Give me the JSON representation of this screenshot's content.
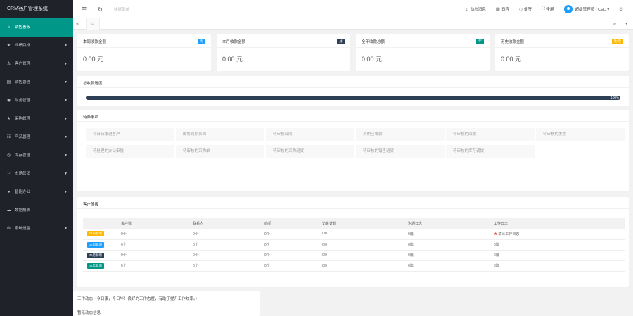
{
  "app_title": "CRM客户管理系统",
  "sidebar": {
    "items": [
      {
        "label": "销售看板",
        "icon": "home-icon",
        "glyph": "⌂",
        "active": true,
        "has_caret": false
      },
      {
        "label": "业绩目标",
        "icon": "star-icon",
        "glyph": "★",
        "active": false,
        "has_caret": true
      },
      {
        "label": "客户管理",
        "icon": "user-icon",
        "glyph": "♙",
        "active": false,
        "has_caret": true
      },
      {
        "label": "销售管理",
        "icon": "chart-icon",
        "glyph": "▤",
        "active": false,
        "has_caret": true
      },
      {
        "label": "财务管理",
        "icon": "money-icon",
        "glyph": "◉",
        "active": false,
        "has_caret": true
      },
      {
        "label": "采购管理",
        "icon": "star-icon",
        "glyph": "★",
        "active": false,
        "has_caret": true
      },
      {
        "label": "产品管理",
        "icon": "product-icon",
        "glyph": "☷",
        "active": false,
        "has_caret": true
      },
      {
        "label": "库存管理",
        "icon": "stock-icon",
        "glyph": "◎",
        "active": false,
        "has_caret": true
      },
      {
        "label": "市场营销",
        "icon": "flag-icon",
        "glyph": "⚐",
        "active": false,
        "has_caret": true
      },
      {
        "label": "智能办公",
        "icon": "office-icon",
        "glyph": "●",
        "active": false,
        "has_caret": true
      },
      {
        "label": "数据报表",
        "icon": "report-icon",
        "glyph": "☁",
        "active": false,
        "has_caret": false
      },
      {
        "label": "系统设置",
        "icon": "gear-icon",
        "glyph": "⚙",
        "active": false,
        "has_caret": true
      }
    ]
  },
  "header": {
    "menu_glyph": "☰",
    "refresh_glyph": "↻",
    "quick_menu": "快捷菜单",
    "right": [
      {
        "label": "动态消息",
        "icon": "bell-icon",
        "glyph": "♫"
      },
      {
        "label": "日程",
        "icon": "calendar-icon",
        "glyph": "▦"
      },
      {
        "label": "便签",
        "icon": "tag-icon",
        "glyph": "◇"
      },
      {
        "label": "全屏",
        "icon": "fullscreen-icon",
        "glyph": "⛶"
      }
    ],
    "user": "超级管理员 - CEO ▾",
    "settings_glyph": "⚙"
  },
  "tabs": {
    "prev": "«",
    "home": "⌂",
    "next": "»",
    "menu": "▾"
  },
  "stats": [
    {
      "title": "本周收款金额",
      "badge": "周",
      "badge_color": "#1e9fff",
      "value": "0.00 元"
    },
    {
      "title": "本月收款金额",
      "badge": "月",
      "badge_color": "#2f4056",
      "value": "0.00 元"
    },
    {
      "title": "全年收款总额",
      "badge": "年",
      "badge_color": "#009688",
      "value": "0.00 元"
    },
    {
      "title": "历史收款金额",
      "badge": "历史",
      "badge_color": "#ffb800",
      "value": "0.00 元"
    }
  ],
  "progress": {
    "title": "总收款进度",
    "percent": 100,
    "text": "100%"
  },
  "todo": {
    "title": "待办事项",
    "items": [
      "今日待跟进客户",
      "即将到期合同",
      "待审核合同",
      "到期应收款",
      "待审核的回款",
      "待审核的发票",
      "待处理的办公审批",
      "待审核的采购单",
      "待审核的采购退货",
      "待审核的销售退货",
      "待审核的库存调拨"
    ]
  },
  "customers": {
    "title": "客户简报",
    "headers": [
      "",
      "客户数",
      "联系人",
      "商机",
      "访客计划",
      "沟通日志",
      "工作日志"
    ],
    "rows": [
      {
        "tag": "今日新增",
        "tag_color": "#ffb800",
        "cells": [
          "0个",
          "0个",
          "0个",
          "0/0",
          "0篇"
        ],
        "last": "填写工作日志",
        "last_star": true
      },
      {
        "tag": "本周新增",
        "tag_color": "#1e9fff",
        "cells": [
          "0个",
          "0个",
          "0个",
          "0/0",
          "0篇"
        ],
        "last": "0篇",
        "last_star": false
      },
      {
        "tag": "本月新增",
        "tag_color": "#2f4056",
        "cells": [
          "0个",
          "0个",
          "0个",
          "0/0",
          "0篇"
        ],
        "last": "0篇",
        "last_star": false
      },
      {
        "tag": "本年新增",
        "tag_color": "#009688",
        "cells": [
          "0个",
          "0个",
          "0个",
          "0/0",
          "0篇"
        ],
        "last": "0篇",
        "last_star": false
      }
    ]
  },
  "worklog": {
    "title": "工作动态（今日事，今日毕！良好的工作态度，有助于提升工作效率。）",
    "empty": "暂无动态信息"
  }
}
